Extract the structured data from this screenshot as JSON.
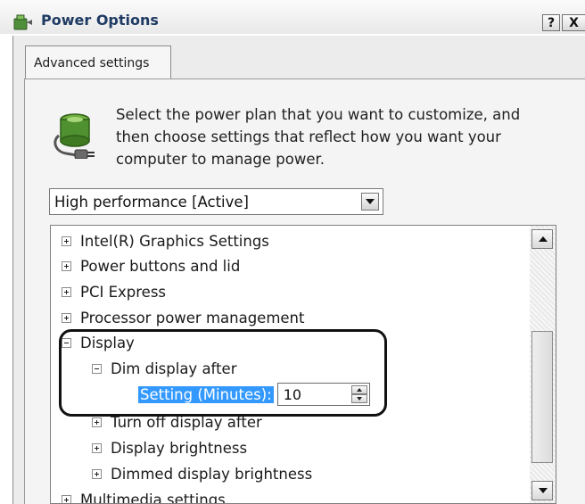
{
  "window": {
    "title": "Power Options",
    "help_label": "?",
    "close_label": "X"
  },
  "tabs": [
    {
      "label": "Advanced settings",
      "active": true
    }
  ],
  "intro": {
    "text": "Select the power plan that you want to customize, and then choose settings that reflect how you want your computer to manage power."
  },
  "plan_select": {
    "value": "High performance [Active]"
  },
  "tree": {
    "items": [
      {
        "label": "Intel(R) Graphics Settings",
        "state": "collapsed"
      },
      {
        "label": "Power buttons and lid",
        "state": "collapsed"
      },
      {
        "label": "PCI Express",
        "state": "collapsed"
      },
      {
        "label": "Processor power management",
        "state": "collapsed"
      },
      {
        "label": "Display",
        "state": "expanded"
      },
      {
        "label": "Dim display after",
        "state": "expanded"
      },
      {
        "label": "Setting (Minutes):",
        "value": "10"
      },
      {
        "label": "Turn off display after",
        "state": "collapsed"
      },
      {
        "label": "Display brightness",
        "state": "collapsed"
      },
      {
        "label": "Dimmed display brightness",
        "state": "collapsed"
      },
      {
        "label": "Multimedia settings",
        "state": "collapsed"
      }
    ]
  },
  "colors": {
    "title_text": "#1f3b63",
    "selection_highlight": "#3399ff",
    "callout_border": "#111111"
  }
}
